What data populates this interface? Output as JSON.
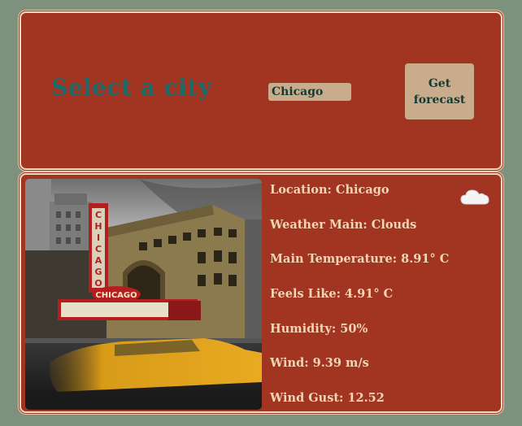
{
  "header": {
    "title": "Select a city",
    "city_select_value": "Chicago",
    "forecast_button_label": "Get forecast"
  },
  "weather": {
    "icon": "cloud-icon",
    "lines": [
      "Location: Chicago",
      "Weather Main: Clouds",
      "Main Temperature: 8.91° C",
      "Feels Like: 4.91° C",
      "Humidity: 50%",
      "Wind: 9.39 m/s",
      "Wind Gust: 12.52"
    ]
  },
  "colors": {
    "background": "#7d917c",
    "panel": "#a23422",
    "panel_border": "#f1d9c0",
    "title": "#1c6b6a",
    "control": "#c9ac8c",
    "info_text": "#f1d6b5"
  }
}
